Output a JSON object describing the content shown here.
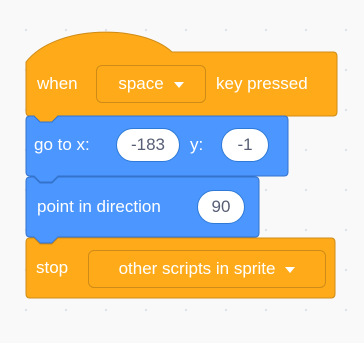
{
  "colors": {
    "events": "#ffab19",
    "events_border": "#cf8b17",
    "motion": "#4c97ff",
    "motion_border": "#3373cc",
    "input_text": "#575e75",
    "canvas": "#f9f9f9"
  },
  "blocks": {
    "when_key_pressed": {
      "label_when": "when",
      "key": "space",
      "label_key_pressed": "key pressed"
    },
    "go_to_xy": {
      "label_go_to_x": "go to x:",
      "x_value": "-183",
      "label_y": "y:",
      "y_value": "-1"
    },
    "point_in_direction": {
      "label": "point in direction",
      "direction_value": "90"
    },
    "stop": {
      "label": "stop",
      "option": "other scripts in sprite"
    }
  }
}
